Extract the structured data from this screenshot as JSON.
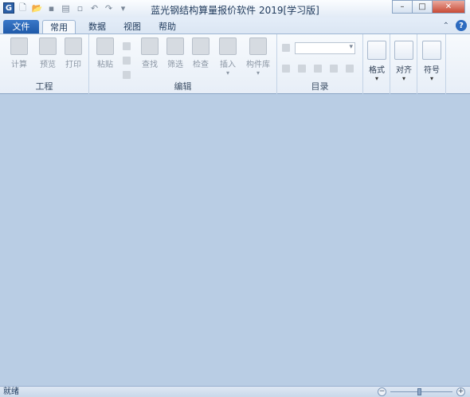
{
  "window": {
    "title": "蓝光钢结构算量报价软件 2019[学习版]",
    "logo": "G",
    "controls": {
      "minimize": "–",
      "restore": "□",
      "close": "✕"
    }
  },
  "quick_access": [
    "new-icon",
    "open-icon",
    "save-icon",
    "print-icon",
    "preview-icon",
    "undo-icon",
    "redo-icon",
    "customize-icon"
  ],
  "tabs": {
    "file": "文件",
    "home": "常用",
    "data": "数据",
    "view": "视图",
    "help": "帮助"
  },
  "ribbon": {
    "project": {
      "label": "工程",
      "calc": "计算",
      "preview": "预览",
      "print": "打印"
    },
    "edit": {
      "label": "编辑",
      "paste": "粘贴",
      "find": "查找",
      "filter": "筛选",
      "check": "检查",
      "insert": "插入",
      "component_lib": "构件库"
    },
    "catalog": {
      "label": "目录"
    },
    "format": {
      "format": "格式",
      "align": "对齐",
      "symbol": "符号"
    }
  },
  "status": {
    "text": "就绪"
  },
  "colors": {
    "workspace": "#b9cde4",
    "file_tab": "#2a62b0"
  }
}
